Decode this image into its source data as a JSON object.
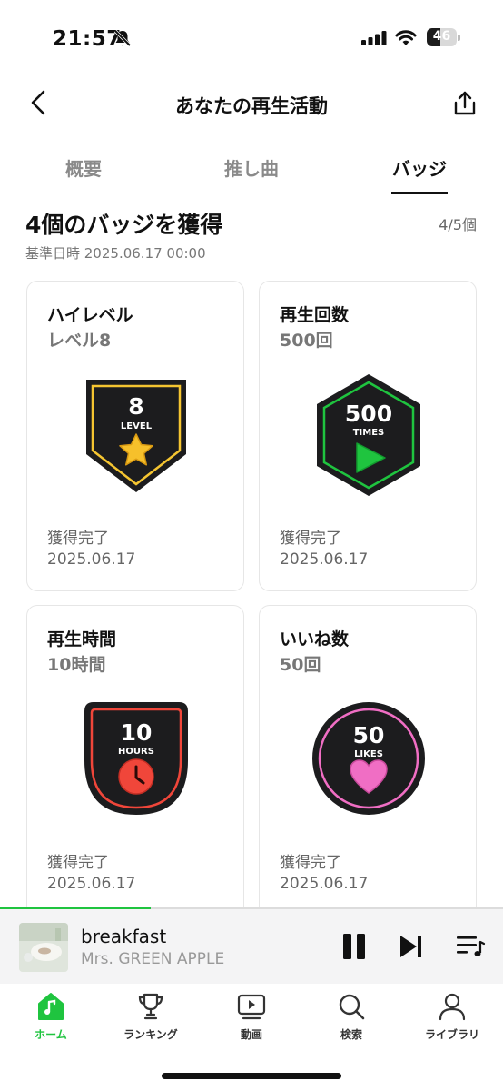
{
  "status_bar": {
    "time": "21:57",
    "battery": "46",
    "battery_level": 0.46
  },
  "header": {
    "title": "あなたの再生活動"
  },
  "tabs": [
    {
      "label": "概要"
    },
    {
      "label": "推し曲"
    },
    {
      "label": "バッジ"
    }
  ],
  "summary": {
    "title": "4個のバッジを獲得",
    "count": "4/5個",
    "date": "基準日時 2025.06.17 00:00"
  },
  "badges": [
    {
      "name": "ハイレベル",
      "level": "レベル8",
      "badge_number": "8",
      "badge_unit": "LEVEL",
      "status": "獲得完了",
      "date": "2025.06.17",
      "color": "#f5c531",
      "icon": "star-icon"
    },
    {
      "name": "再生回数",
      "level": "500回",
      "badge_number": "500",
      "badge_unit": "TIMES",
      "status": "獲得完了",
      "date": "2025.06.17",
      "color": "#1fc43f",
      "icon": "play-icon"
    },
    {
      "name": "再生時間",
      "level": "10時間",
      "badge_number": "10",
      "badge_unit": "HOURS",
      "status": "獲得完了",
      "date": "2025.06.17",
      "color": "#f0463a",
      "icon": "clock-icon"
    },
    {
      "name": "いいね数",
      "level": "50回",
      "badge_number": "50",
      "badge_unit": "LIKES",
      "status": "獲得完了",
      "date": "2025.06.17",
      "color": "#f06ec4",
      "icon": "heart-icon"
    }
  ],
  "player": {
    "track": "breakfast",
    "artist": "Mrs. GREEN APPLE",
    "progress": 0.3
  },
  "tabbar": [
    {
      "label": "ホーム",
      "icon": "home-icon"
    },
    {
      "label": "ランキング",
      "icon": "trophy-icon"
    },
    {
      "label": "動画",
      "icon": "video-icon"
    },
    {
      "label": "検索",
      "icon": "search-icon"
    },
    {
      "label": "ライブラリ",
      "icon": "person-icon"
    }
  ],
  "colors": {
    "accent": "#1fc43f"
  }
}
